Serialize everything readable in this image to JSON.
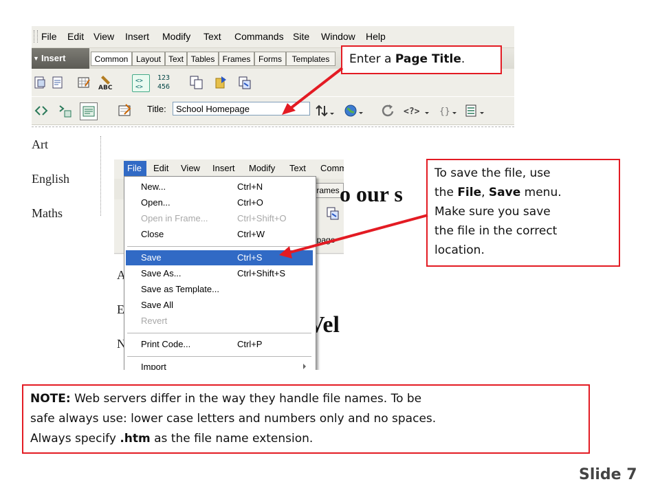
{
  "window1": {
    "menu": [
      "File",
      "Edit",
      "View",
      "Insert",
      "Modify",
      "Text",
      "Commands",
      "Site",
      "Window",
      "Help"
    ],
    "insert_label": "Insert",
    "insert_tabs": [
      "Common",
      "Layout",
      "Text",
      "Tables",
      "Frames",
      "Forms",
      "Templates"
    ],
    "icon_text": {
      "numbers_top": "123",
      "numbers_bottom": "456",
      "abc": "ABC"
    },
    "title_label": "Title:",
    "title_value": "School Homepage",
    "bracket_glyph": "{}"
  },
  "nav_links": [
    "Art",
    "English",
    "Maths"
  ],
  "window2": {
    "menu": [
      "File",
      "Edit",
      "View",
      "Insert",
      "Modify",
      "Text",
      "Comm"
    ],
    "frames_tab": "rames",
    "heading_fragment": "o our s",
    "welcome_fragment": "Vel",
    "page_fragment": "epage",
    "letters": [
      "A",
      "E",
      "N"
    ],
    "file_menu": [
      {
        "label": "New...",
        "shortcut": "Ctrl+N",
        "state": "normal"
      },
      {
        "label": "Open...",
        "shortcut": "Ctrl+O",
        "state": "normal"
      },
      {
        "label": "Open in Frame...",
        "shortcut": "Ctrl+Shift+O",
        "state": "disabled"
      },
      {
        "label": "Close",
        "shortcut": "Ctrl+W",
        "state": "normal"
      },
      {
        "label": "Save",
        "shortcut": "Ctrl+S",
        "state": "selected"
      },
      {
        "label": "Save As...",
        "shortcut": "Ctrl+Shift+S",
        "state": "normal"
      },
      {
        "label": "Save as Template...",
        "shortcut": "",
        "state": "normal"
      },
      {
        "label": "Save All",
        "shortcut": "",
        "state": "normal"
      },
      {
        "label": "Revert",
        "shortcut": "",
        "state": "disabled"
      },
      {
        "label": "Print Code...",
        "shortcut": "Ctrl+P",
        "state": "normal"
      },
      {
        "label": "Import",
        "shortcut": "",
        "state": "submenu"
      }
    ]
  },
  "callouts": {
    "title": {
      "prefix": "Enter a ",
      "bold": "Page Title",
      "suffix": "."
    },
    "save": {
      "line1": "To save the file, use",
      "line2_a": "the ",
      "line2_file": "File",
      "line2_b": ", ",
      "line2_save": "Save",
      "line2_c": " menu.",
      "line3": "Make sure you save",
      "line4": "the file in the correct",
      "line5": "location."
    },
    "note": {
      "label": "NOTE:",
      "line1": " Web servers differ in the way they handle file names. To be",
      "line2": "safe always use: lower case letters and numbers only and no spaces.",
      "line3_a": "Always specify  ",
      "line3_ext": ".htm",
      "line3_b": " as the file name extension."
    }
  },
  "slide_label": "Slide 7",
  "colors": {
    "callout_border": "#e31b23",
    "menu_highlight": "#316ac5",
    "arrow": "#e31b23"
  }
}
